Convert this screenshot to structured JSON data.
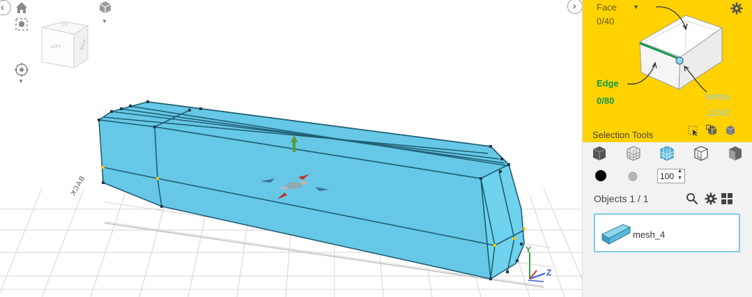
{
  "viewcube": {
    "face_left": "LEFT",
    "face_right": "BACK",
    "face_top": "TOP"
  },
  "viewport": {
    "back_label": "BACK",
    "axis_y": "Y",
    "axis_z": "Z"
  },
  "selection_panel": {
    "face_label": "Face",
    "face_count": "0/40",
    "edge_label": "Edge",
    "edge_count": "0/80",
    "vertex_label": "Vertex",
    "vertex_count": "12/42",
    "title": "Selection Tools"
  },
  "tools": {
    "size_value": "100"
  },
  "objects": {
    "header": "Objects 1 / 1",
    "items": [
      {
        "name": "mesh_4"
      }
    ]
  },
  "colors": {
    "accent": "#ffd200",
    "mesh": "#66c8e6",
    "edge": "#0e9a4a",
    "vertex": "#9fd3ee"
  }
}
